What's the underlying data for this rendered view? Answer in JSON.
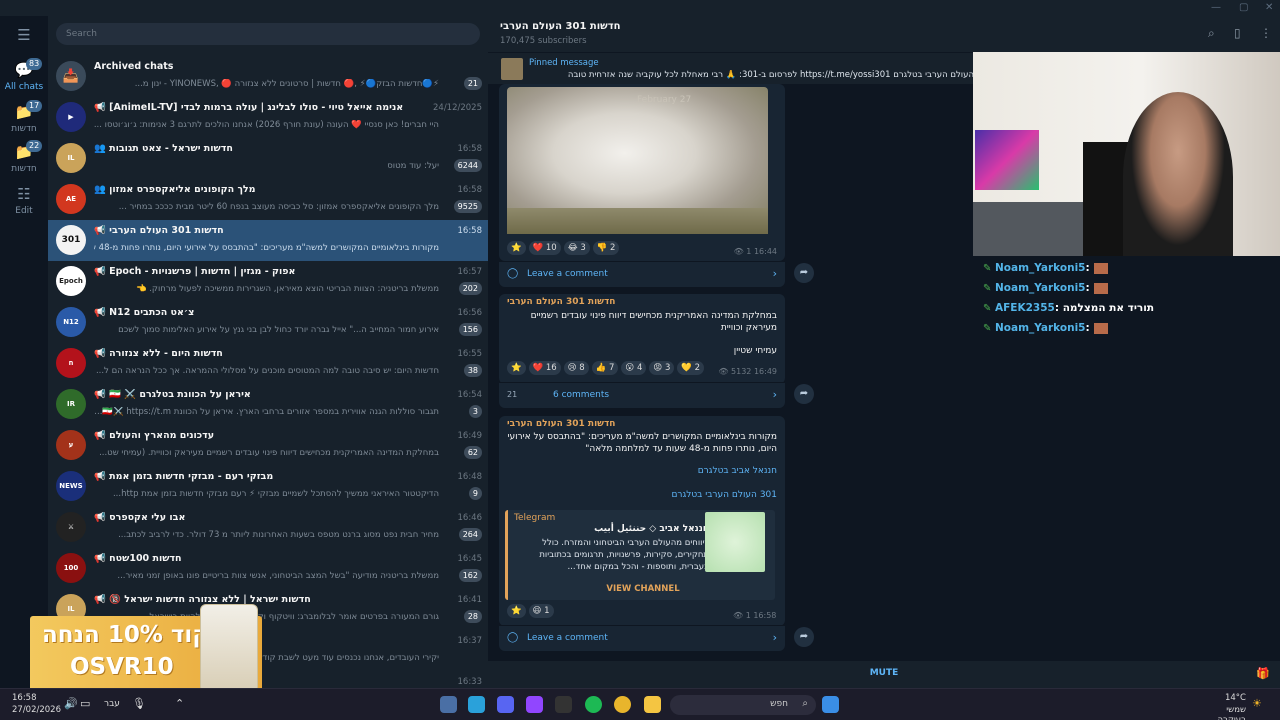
{
  "search": {
    "placeholder": "Search"
  },
  "folders": [
    {
      "label": "All chats",
      "badge": "83",
      "icon": "chats-icon"
    },
    {
      "label": "חדשות",
      "badge": "17",
      "icon": "folder-icon"
    },
    {
      "label": "חדשות",
      "badge": "22",
      "icon": "folder-icon"
    },
    {
      "label": "Edit",
      "badge": "",
      "icon": "sliders-icon"
    }
  ],
  "archive": {
    "name": "Archived chats",
    "preview": "⚡🔵חדשות הבזק🔵⚡ ,🔴 חדשות | סרטונים ללא צנזורה 🔴 ,YINONEWS - ינון מ...",
    "badge": "21"
  },
  "chats": [
    {
      "name": "📢 [AnimeIL-TV] אנימה אייאל טיוי - סולו לבלינג | עולה ברמות לבדי",
      "time": "24/12/2025",
      "preview": "היי חברים! כאן סנסיי ❤️ העונה (עונת חורף 2026) אנחנו הולכים לתרגם 3 אנימות: ג׳וג׳וטסו ...",
      "badge": ""
    },
    {
      "name": "👥 חדשות ישראל - צאט תגובות",
      "time": "16:58",
      "preview": "יעל: עוד מטוס",
      "badge": "6244"
    },
    {
      "name": "👥 מלך הקופונים אליאקספרס אמזון",
      "time": "16:58",
      "preview": "מלך הקופונים אליאקספרס אמזון: סל כביסה מעוצב בנפח 60 ליטר מבית ככככ במחיר ...",
      "badge": "9525"
    },
    {
      "name": "📢 חדשות 301 העולם הערבי",
      "time": "16:58",
      "preview": "מקורות בינלאומיים המקושרים למשה\"מ מעריכים: \"בהתבסס על אירועי היום, נותרו פחות מ-48 שעו...",
      "badge": ""
    },
    {
      "name": "📢 Epoch - אפוק - מגזין | חדשות | פרשנויות",
      "time": "16:57",
      "preview": "ממשלת בריטניה: הצוות הבריטי הוצא מאיראן, השגרירות ממשיכה לפעול מרחוק. 👈",
      "badge": "202"
    },
    {
      "name": "📢 N12 צ׳אט הכתבים",
      "time": "16:56",
      "preview": "אירוע חמור המחייב ה...\" אייל גברה יורד כחול לבן בני גנץ על אירוע האלימות סמוך לשכם",
      "badge": "156"
    },
    {
      "name": "📢 חדשות היום - ללא צנזורה",
      "time": "16:55",
      "preview": "חדשות היום: יש סיבה טובה למה המטוסים מוכנים על מסלולי ההמראה. אך ככל הנראה הם ל...",
      "badge": "38"
    },
    {
      "name": "📢 🇮🇷 ⚔️ איראן על הכוונת בטלגרם",
      "time": "16:54",
      "preview": "תגבור סוללות הגנה אווירית במספר אזורים ברחבי הארץ. איראן על הכוונת 🇮🇷⚔️ https://t.m...",
      "badge": "3"
    },
    {
      "name": "📢 עדכונים מהארץ והעולם",
      "time": "16:49",
      "preview": "במחלקת המדינה האמריקנית מכחישים דיווח פינוי עובדים רשמיים מעיראק וכוויית. (עמיחי שט...",
      "badge": "62"
    },
    {
      "name": "📢 מבזקי רעם - מבזקי חדשות בזמן אמת",
      "time": "16:48",
      "preview": "הדיקטטור האיראני ממשיך להסתכל לשמיים מבזקי ⚡ רעם מבזקי חדשות בזמן אמת http...",
      "badge": "9"
    },
    {
      "name": "📢 אבו עלי אקספרס",
      "time": "16:46",
      "preview": "מחיר חבית נפט מסוג ברנט מטפס בשעות האחרונות ליותר מ 73 דולר. כדי לרביב לכתב...",
      "badge": "264"
    },
    {
      "name": "📢 חדשות 100שטח",
      "time": "16:45",
      "preview": "ממשלת בריטניה מודיעה \"בשל המצב הביטחוני, אנשי צוות בריטיים פונו באופן זמני מאיר...",
      "badge": "162"
    },
    {
      "name": "📢 🔞 חדשות ישראל | ללא צנזורה חדשות ישראל",
      "time": "16:41",
      "preview": "גורם המעורה בפרטים אומר לבלומברג: וויטקוף וקושנר לא צפויים להיות בישראל ...",
      "badge": "28"
    },
    {
      "name": "",
      "time": "16:37",
      "preview": "יקירי העובדים, אנחנו נכנסים עוד מעט לשבת קודש. אנחנו...",
      "badge": ""
    },
    {
      "name": "",
      "time": "16:33",
      "preview": "",
      "badge": ""
    }
  ],
  "ad": {
    "line1": "קוד 10% הנחה",
    "line2": "OSVR10"
  },
  "channel": {
    "title": "חדשות 301 העולם הערבי",
    "subs": "170,475 subscribers"
  },
  "pinned": {
    "label": "Pinned message",
    "text": "העולם הערבי בטלגרם https://t.me/yossi301 לפרסום ב-301: 🙏 רבי מאחלת לכל עוקביה שנה אזרחית טובה"
  },
  "posts": {
    "p1": {
      "watermark": "February 27",
      "reactions": [
        "⭐",
        "❤️ 10",
        "😂 3",
        "👎 2"
      ],
      "views": "1",
      "time": "16:44",
      "comments": "Leave a comment"
    },
    "p2": {
      "title": "חדשות 301 העולם הערבי",
      "text": "במחלקת המדינה האמריקנית מכחישים דיווח פינוי עובדים רשמיים מעיראק וכוויית",
      "author": "עמיחי שטיין",
      "reactions": [
        "⭐",
        "❤️ 16",
        "😢 8",
        "👍 7",
        "😮 4",
        "😡 3",
        "💛 2"
      ],
      "views": "5132",
      "time": "16:49",
      "comments": "6 comments",
      "avatar_count": "21"
    },
    "p3": {
      "title": "חדשות 301 העולם הערבי",
      "text": "מקורות בינלאומיים המקושרים למשה\"מ מעריכים: \"בהתבסס על אירועי היום, נותרו פחות מ-48 שעות עד למלחמה מלאה\"",
      "link1": "חננאל אביב בטלגרם",
      "link2": "301 העולם הערבי בטלגרם",
      "preview_site": "Telegram",
      "preview_title": "חננאל אביב ◇ حننئيل أبيب",
      "preview_desc": "דיווחים מהעולם הערבי הביטחוני והמזרח. כולל תחקירים, סקירות, פרשנויות, תרגומים בכתוביות בעברית, ותוספות - והכל במקום אחד...",
      "preview_button": "VIEW CHANNEL",
      "reactions": [
        "⭐",
        "😆 1"
      ],
      "views": "1",
      "time": "16:58",
      "comments": "Leave a comment"
    }
  },
  "mute": "MUTE",
  "stream_chat": [
    {
      "user": "Noam_Yarkoni5",
      "msg": ":"
    },
    {
      "user": "Noam_Yarkoni5",
      "msg": ":"
    },
    {
      "user": "AFEK2355",
      "msg": ": תוריד את המצלמה"
    },
    {
      "user": "Noam_Yarkoni5",
      "msg": ":"
    }
  ],
  "taskbar": {
    "time": "16:58",
    "date": "27/02/2026",
    "lang": "עבר",
    "search": "חפש",
    "weather": "14°C",
    "weather_desc": "שמשי בעיקרה"
  }
}
